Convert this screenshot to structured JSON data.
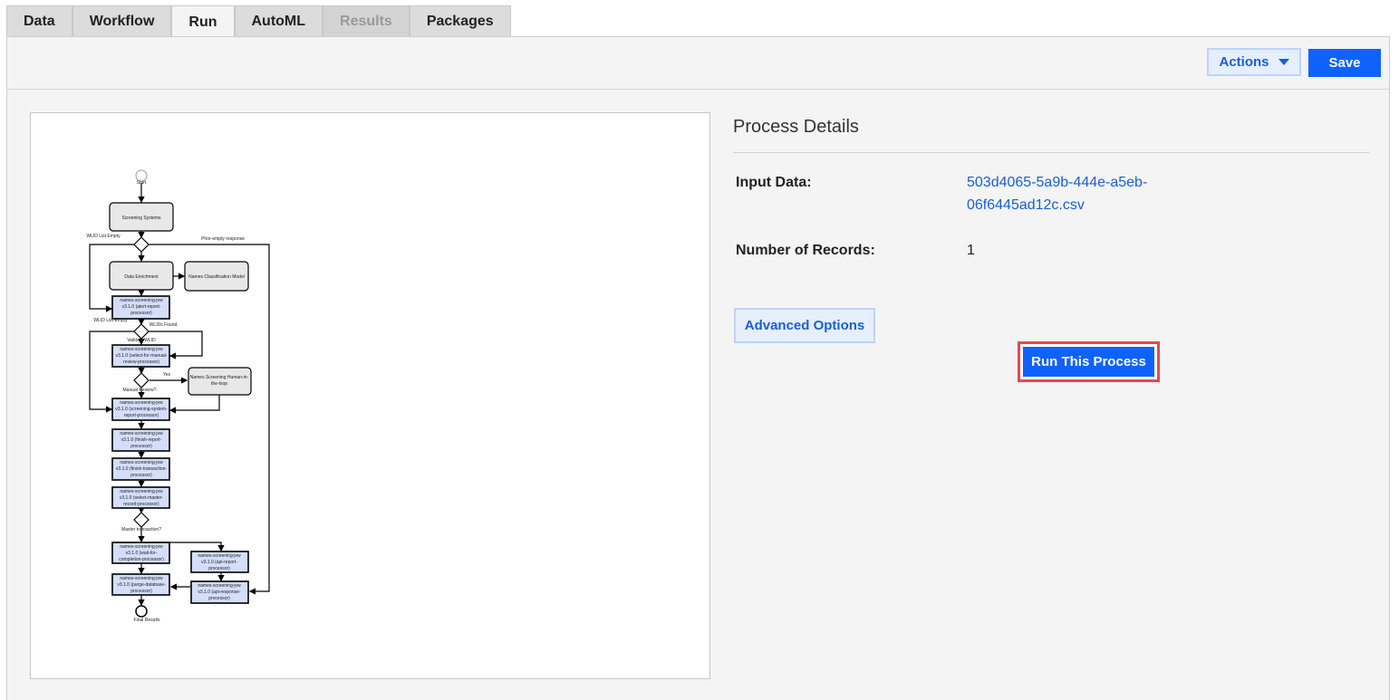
{
  "tabs": [
    {
      "label": "Data"
    },
    {
      "label": "Workflow"
    },
    {
      "label": "Run"
    },
    {
      "label": "AutoML"
    },
    {
      "label": "Results"
    },
    {
      "label": "Packages"
    }
  ],
  "toolbar": {
    "actions_label": "Actions",
    "save_label": "Save"
  },
  "details": {
    "title": "Process Details",
    "input_label": "Input Data:",
    "input_value_line1": "503d4065-5a9b-444e-a5eb-",
    "input_value_line2": "06f6445ad12c.csv",
    "records_label": "Number of Records:",
    "records_value": "1",
    "advanced_label": "Advanced Options",
    "run_label": "Run This Process"
  },
  "colors": {
    "primary": "#0f62fe",
    "link": "#1a5fd1",
    "highlight": "#e8474d",
    "node_blue": "#d4defa"
  },
  "diagram": {
    "start": "Start",
    "end": "Final Results",
    "screening_systems": "Screening Systems",
    "wlid_list_empty": "WLID List Empty",
    "prev_response": "Prior-empty response",
    "data_enrichment": "Data Enrichment",
    "names_classification": "Names Classification Model",
    "wlid_list_empty2": "WLID List Empty",
    "wlids_found": "WLIDs Found",
    "validate": "Validate WLID",
    "yes": "Yes",
    "manual_review": "Manual Review?",
    "human_loop_1": "Names Screening Human-in-",
    "human_loop_2": "the-loop",
    "master_txn": "Master transaction?",
    "p1": [
      "names-screening-jvw",
      "v3.1.0 (alert-report-",
      "processor)"
    ],
    "p2": [
      "names-screening-jvw",
      "v3.1.0 (select-for-manual-",
      "review-processor)"
    ],
    "p3": [
      "names-screening-jvw",
      "v3.1.0 (screening-system-",
      "report-processor)"
    ],
    "p4": [
      "names-screening-jvw",
      "v3.1.0 (finish-report-",
      "processor)"
    ],
    "p5": [
      "names-screening-jvw",
      "v3.1.0 (finish-transaction-",
      "processor)"
    ],
    "p6": [
      "names-screening-jvw",
      "v3.1.0 (select-master-",
      "record-processor)"
    ],
    "p7": [
      "names-screening-jvw",
      "v3.1.0 (wait-for-",
      "completion-processor)"
    ],
    "p8": [
      "names-screening-jvw",
      "v3.1.0 (api-report-",
      "processor)"
    ],
    "p9": [
      "names-screening-jvw",
      "v3.1.0 (purge-database-",
      "processor)"
    ],
    "p10": [
      "names-screening-jvw",
      "v3.1.0 (api-response-",
      "processor)"
    ]
  }
}
